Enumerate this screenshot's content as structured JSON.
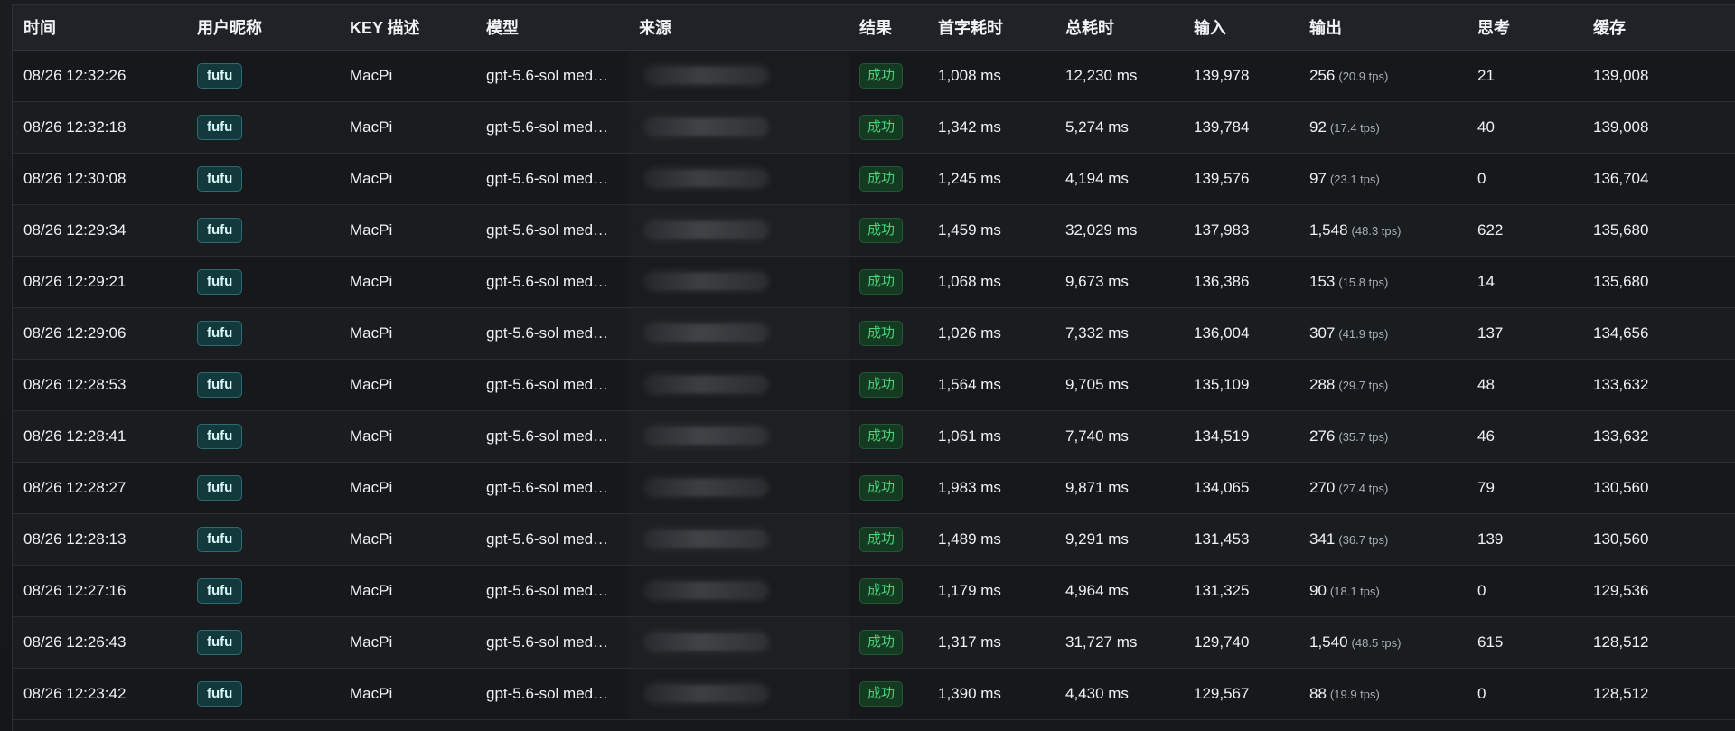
{
  "table": {
    "headers": {
      "time": "时间",
      "user": "用户昵称",
      "key": "KEY 描述",
      "model": "模型",
      "source": "来源",
      "result": "结果",
      "first_token": "首字耗时",
      "total": "总耗时",
      "input": "输入",
      "output": "输出",
      "thinking": "思考",
      "cache": "缓存"
    },
    "rows": [
      {
        "time": "08/26 12:32:26",
        "user": "fufu",
        "key": "MacPi",
        "model": "gpt-5.6-sol med…",
        "result": "成功",
        "first_token": "1,008 ms",
        "total": "12,230 ms",
        "input": "139,978",
        "output": "256",
        "tps": "(20.9 tps)",
        "thinking": "21",
        "cache": "139,008"
      },
      {
        "time": "08/26 12:32:18",
        "user": "fufu",
        "key": "MacPi",
        "model": "gpt-5.6-sol med…",
        "result": "成功",
        "first_token": "1,342 ms",
        "total": "5,274 ms",
        "input": "139,784",
        "output": "92",
        "tps": "(17.4 tps)",
        "thinking": "40",
        "cache": "139,008"
      },
      {
        "time": "08/26 12:30:08",
        "user": "fufu",
        "key": "MacPi",
        "model": "gpt-5.6-sol med…",
        "result": "成功",
        "first_token": "1,245 ms",
        "total": "4,194 ms",
        "input": "139,576",
        "output": "97",
        "tps": "(23.1 tps)",
        "thinking": "0",
        "cache": "136,704"
      },
      {
        "time": "08/26 12:29:34",
        "user": "fufu",
        "key": "MacPi",
        "model": "gpt-5.6-sol med…",
        "result": "成功",
        "first_token": "1,459 ms",
        "total": "32,029 ms",
        "input": "137,983",
        "output": "1,548",
        "tps": "(48.3 tps)",
        "thinking": "622",
        "cache": "135,680"
      },
      {
        "time": "08/26 12:29:21",
        "user": "fufu",
        "key": "MacPi",
        "model": "gpt-5.6-sol med…",
        "result": "成功",
        "first_token": "1,068 ms",
        "total": "9,673 ms",
        "input": "136,386",
        "output": "153",
        "tps": "(15.8 tps)",
        "thinking": "14",
        "cache": "135,680"
      },
      {
        "time": "08/26 12:29:06",
        "user": "fufu",
        "key": "MacPi",
        "model": "gpt-5.6-sol med…",
        "result": "成功",
        "first_token": "1,026 ms",
        "total": "7,332 ms",
        "input": "136,004",
        "output": "307",
        "tps": "(41.9 tps)",
        "thinking": "137",
        "cache": "134,656"
      },
      {
        "time": "08/26 12:28:53",
        "user": "fufu",
        "key": "MacPi",
        "model": "gpt-5.6-sol med…",
        "result": "成功",
        "first_token": "1,564 ms",
        "total": "9,705 ms",
        "input": "135,109",
        "output": "288",
        "tps": "(29.7 tps)",
        "thinking": "48",
        "cache": "133,632"
      },
      {
        "time": "08/26 12:28:41",
        "user": "fufu",
        "key": "MacPi",
        "model": "gpt-5.6-sol med…",
        "result": "成功",
        "first_token": "1,061 ms",
        "total": "7,740 ms",
        "input": "134,519",
        "output": "276",
        "tps": "(35.7 tps)",
        "thinking": "46",
        "cache": "133,632"
      },
      {
        "time": "08/26 12:28:27",
        "user": "fufu",
        "key": "MacPi",
        "model": "gpt-5.6-sol med…",
        "result": "成功",
        "first_token": "1,983 ms",
        "total": "9,871 ms",
        "input": "134,065",
        "output": "270",
        "tps": "(27.4 tps)",
        "thinking": "79",
        "cache": "130,560"
      },
      {
        "time": "08/26 12:28:13",
        "user": "fufu",
        "key": "MacPi",
        "model": "gpt-5.6-sol med…",
        "result": "成功",
        "first_token": "1,489 ms",
        "total": "9,291 ms",
        "input": "131,453",
        "output": "341",
        "tps": "(36.7 tps)",
        "thinking": "139",
        "cache": "130,560"
      },
      {
        "time": "08/26 12:27:16",
        "user": "fufu",
        "key": "MacPi",
        "model": "gpt-5.6-sol med…",
        "result": "成功",
        "first_token": "1,179 ms",
        "total": "4,964 ms",
        "input": "131,325",
        "output": "90",
        "tps": "(18.1 tps)",
        "thinking": "0",
        "cache": "129,536"
      },
      {
        "time": "08/26 12:26:43",
        "user": "fufu",
        "key": "MacPi",
        "model": "gpt-5.6-sol med…",
        "result": "成功",
        "first_token": "1,317 ms",
        "total": "31,727 ms",
        "input": "129,740",
        "output": "1,540",
        "tps": "(48.5 tps)",
        "thinking": "615",
        "cache": "128,512"
      },
      {
        "time": "08/26 12:23:42",
        "user": "fufu",
        "key": "MacPi",
        "model": "gpt-5.6-sol med…",
        "result": "成功",
        "first_token": "1,390 ms",
        "total": "4,430 ms",
        "input": "129,567",
        "output": "88",
        "tps": "(19.9 tps)",
        "thinking": "0",
        "cache": "128,512"
      }
    ]
  },
  "colors": {
    "background": "#17191b",
    "success": "#4ed07a",
    "user_badge": "#123a3d"
  }
}
